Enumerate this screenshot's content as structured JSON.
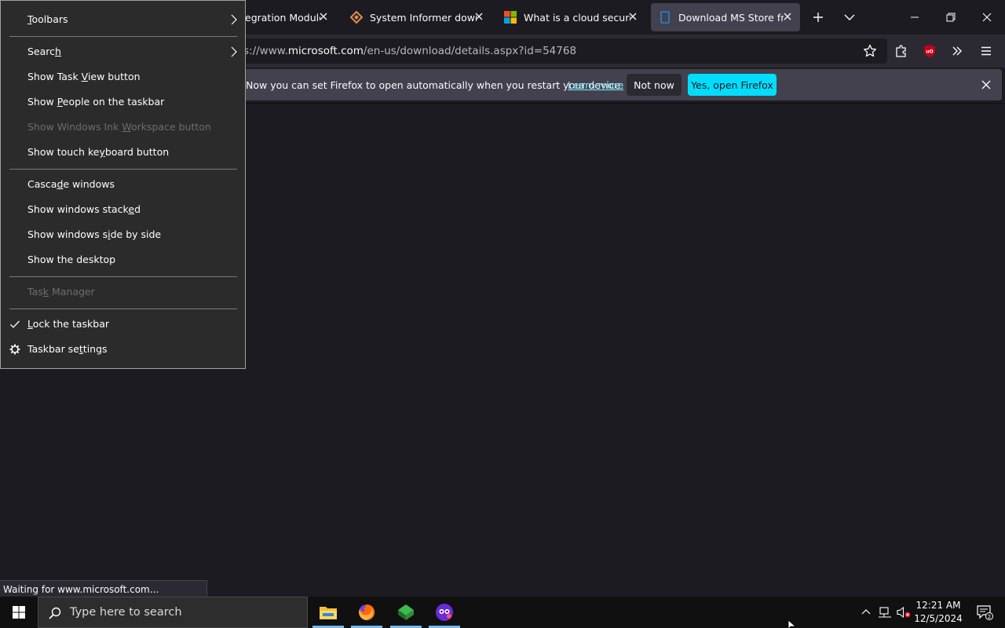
{
  "browser": {
    "tabs": [
      {
        "title": "egration Module -",
        "favicon": "module-favicon",
        "active": false
      },
      {
        "title": "System Informer downlo",
        "favicon": "system-informer-favicon",
        "active": false
      },
      {
        "title": "What is a cloud security s",
        "favicon": "microsoft-favicon",
        "active": false
      },
      {
        "title": "Download MS Store from",
        "favicon": "page-favicon",
        "active": true
      }
    ],
    "url_prefix": "s://www.",
    "url_host": "microsoft.com",
    "url_path": "/en-us/download/details.aspx?id=54768",
    "notification": {
      "message": "Now you can set Firefox to open automatically when you restart your device.",
      "learn_more": "Learn more",
      "not_now": "Not now",
      "yes_open": "Yes, open Firefox"
    },
    "status_text": "Waiting for www.microsoft.com..."
  },
  "context_menu": {
    "items": [
      {
        "pre": "",
        "ul": "T",
        "post": "oolbars",
        "submenu": true,
        "disabled": false,
        "icon": ""
      },
      {
        "pre": "Searc",
        "ul": "h",
        "post": "",
        "submenu": true,
        "disabled": false,
        "icon": ""
      },
      {
        "pre": "Show Task ",
        "ul": "V",
        "post": "iew button",
        "submenu": false,
        "disabled": false,
        "icon": ""
      },
      {
        "pre": "Show ",
        "ul": "P",
        "post": "eople on the taskbar",
        "submenu": false,
        "disabled": false,
        "icon": ""
      },
      {
        "pre": "Show Windows Ink ",
        "ul": "W",
        "post": "orkspace button",
        "submenu": false,
        "disabled": true,
        "icon": ""
      },
      {
        "pre": "Show touch ke",
        "ul": "y",
        "post": "board button",
        "submenu": false,
        "disabled": false,
        "icon": ""
      },
      {
        "pre": "Casca",
        "ul": "d",
        "post": "e windows",
        "submenu": false,
        "disabled": false,
        "icon": ""
      },
      {
        "pre": "Show windows stack",
        "ul": "e",
        "post": "d",
        "submenu": false,
        "disabled": false,
        "icon": ""
      },
      {
        "pre": "Show windows s",
        "ul": "i",
        "post": "de by side",
        "submenu": false,
        "disabled": false,
        "icon": ""
      },
      {
        "pre": "Show the desktop",
        "ul": "",
        "post": "",
        "submenu": false,
        "disabled": false,
        "icon": ""
      },
      {
        "pre": "Tas",
        "ul": "k",
        "post": " Manager",
        "submenu": false,
        "disabled": true,
        "icon": ""
      },
      {
        "pre": "",
        "ul": "L",
        "post": "ock the taskbar",
        "submenu": false,
        "disabled": false,
        "icon": "check-icon"
      },
      {
        "pre": "Taskbar se",
        "ul": "t",
        "post": "tings",
        "submenu": false,
        "disabled": false,
        "icon": "gear-icon"
      }
    ]
  },
  "taskbar": {
    "search_placeholder": "Type here to search",
    "apps": [
      "file-explorer-icon",
      "firefox-icon",
      "app-green-icon",
      "app-purple-icon"
    ],
    "time": "12:21 AM",
    "date": "12/5/2024",
    "notification_count": "2"
  },
  "colors": {
    "accent": "#00ddff",
    "link": "#80ebff",
    "taskbar_indicator": "#76b9ed"
  }
}
